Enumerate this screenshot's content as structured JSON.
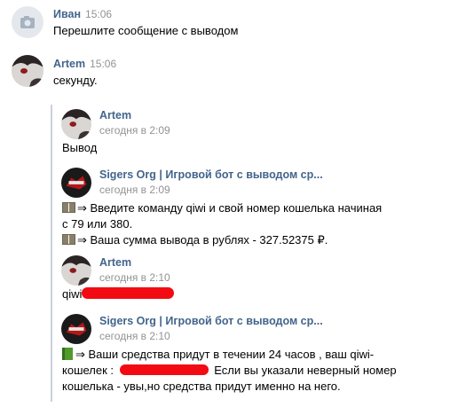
{
  "messages": [
    {
      "author": "Иван",
      "time": "15:06",
      "text": "Перешлите сообщение с выводом"
    },
    {
      "author": "Artem",
      "time": "15:06",
      "text": "секунду."
    }
  ],
  "forwarded": [
    {
      "author": "Artem",
      "date": "сегодня в 2:09",
      "lines": [
        "Вывод"
      ]
    },
    {
      "author": "Sigers Org | Игровой бот с выводом ср...",
      "date": "сегодня в 2:09",
      "lines": [
        "⇒ Введите команду qiwi и свой номер кошелька начиная",
        "с 79 или 380.",
        "⇒ Ваша сумма вывода в рублях - 327.52375 ₽."
      ]
    },
    {
      "author": "Artem",
      "date": "сегодня в 2:10",
      "lines": [
        "qiwi"
      ]
    },
    {
      "author": "Sigers Org | Игровой бот с выводом ср...",
      "date": "сегодня в 2:10",
      "lines": [
        "⇒ Ваши средства придут в течении 24 часов , ваш qiwi-",
        "кошелек :",
        "Если вы указали неверный номер",
        "кошелька - увы,но средства придут именно на него."
      ]
    }
  ],
  "colors": {
    "author": "#42648b",
    "meta": "#939393",
    "redaction": "#f20b12",
    "quote_bar": "#c7d1dc"
  }
}
